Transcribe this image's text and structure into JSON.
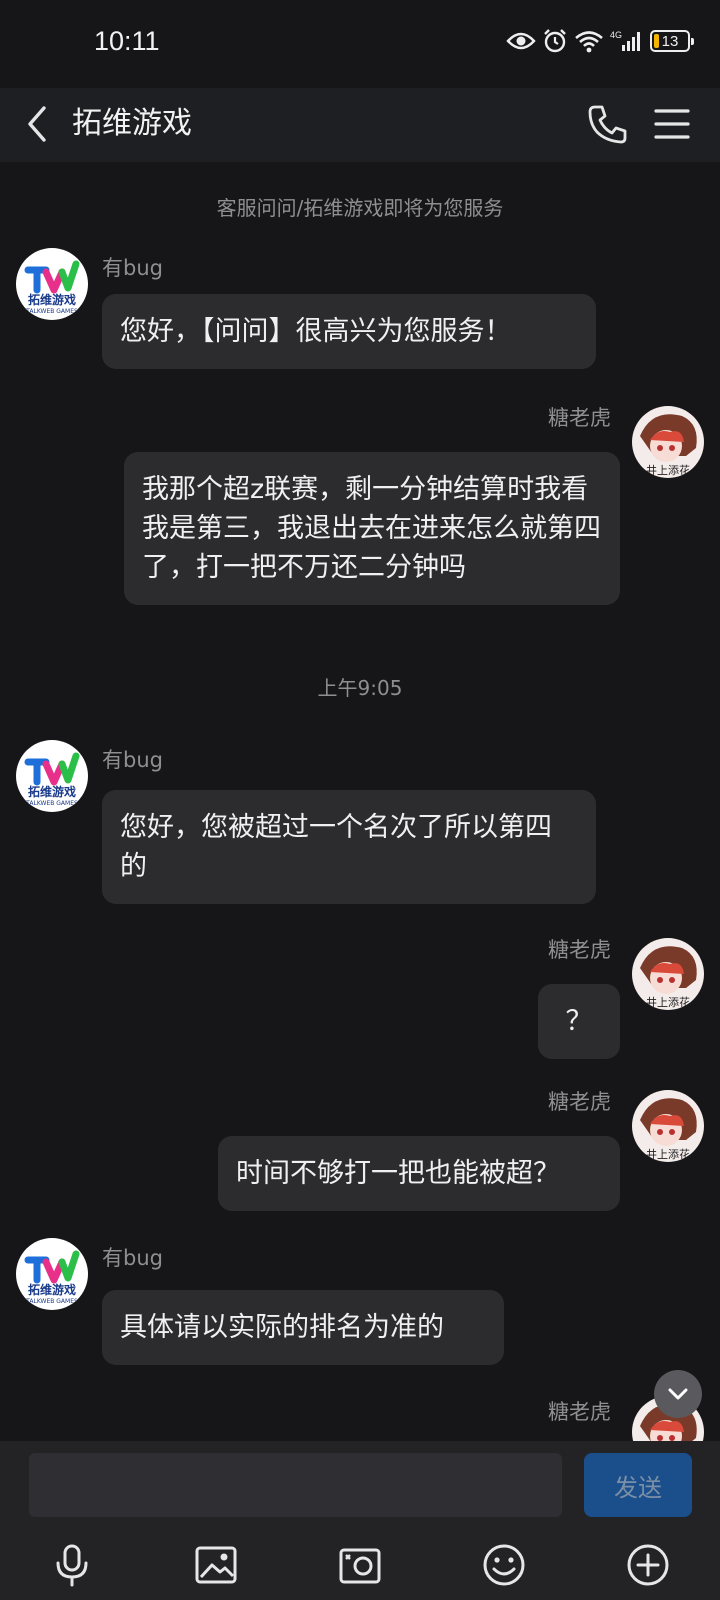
{
  "status_bar": {
    "time": "10:11",
    "battery": "13"
  },
  "header": {
    "title": "拓维游戏"
  },
  "chat": {
    "system_notice": "客服问问/拓维游戏即将为您服务",
    "timestamp": "上午9:05",
    "messages": [
      {
        "sender": "有bug",
        "side": "left",
        "text": "您好，【问问】很高兴为您服务！"
      },
      {
        "sender": "糖老虎",
        "side": "right",
        "text": "我那个超z联赛，剩一分钟结算时我看我是第三，我退出去在进来怎么就第四了，打一把不万还二分钟吗"
      },
      {
        "sender": "有bug",
        "side": "left",
        "text": "您好，您被超过一个名次了所以第四的"
      },
      {
        "sender": "糖老虎",
        "side": "right",
        "text": "？"
      },
      {
        "sender": "糖老虎",
        "side": "right",
        "text": "时间不够打一把也能被超？"
      },
      {
        "sender": "有bug",
        "side": "left",
        "text": "具体请以实际的排名为准的"
      },
      {
        "sender": "糖老虎",
        "side": "right",
        "text": ""
      }
    ]
  },
  "avatars": {
    "agent_logo_text": "拓维游戏",
    "agent_logo_sub": "TALKWEB GAMES",
    "user_avatar_text": "井上添花"
  },
  "input_bar": {
    "input_value": "",
    "send_label": "发送"
  },
  "icons": [
    "eye-icon",
    "alarm-icon",
    "wifi-icon",
    "signal-icon",
    "battery-icon",
    "back-arrow-icon",
    "phone-icon",
    "menu-icon",
    "chevron-down-icon",
    "microphone-icon",
    "image-icon",
    "camera-icon",
    "emoji-icon",
    "plus-circle-icon"
  ],
  "colors": {
    "background": "#161618",
    "bubble": "#2c2c2f",
    "send_button": "#1b4f8c",
    "battery_level": "#f5b400"
  }
}
